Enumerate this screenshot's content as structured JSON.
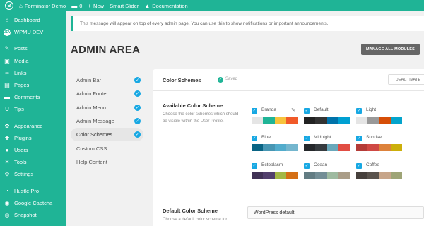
{
  "admin_bar": {
    "logo_letter": "B",
    "site_name": "Forminator Demo",
    "comments_count": "0",
    "new_label": "New",
    "slider_label": "Smart Slider",
    "documentation_label": "Documentation"
  },
  "sidebar": {
    "items": [
      {
        "label": "Dashboard",
        "icon": "dashboard-icon",
        "glyph": "⌂"
      },
      {
        "label": "WPMU DEV",
        "icon": "wpmu-dev-icon",
        "glyph": "DEV"
      },
      {
        "label": "Posts",
        "icon": "pin-icon",
        "glyph": "✎"
      },
      {
        "label": "Media",
        "icon": "media-icon",
        "glyph": "▣"
      },
      {
        "label": "Links",
        "icon": "link-icon",
        "glyph": "∞"
      },
      {
        "label": "Pages",
        "icon": "pages-icon",
        "glyph": "▤"
      },
      {
        "label": "Comments",
        "icon": "comments-icon",
        "glyph": "▬"
      },
      {
        "label": "Tips",
        "icon": "tips-icon",
        "glyph": "U"
      },
      {
        "label": "Appearance",
        "icon": "appearance-icon",
        "glyph": "✿"
      },
      {
        "label": "Plugins",
        "icon": "plugins-icon",
        "glyph": "✚"
      },
      {
        "label": "Users",
        "icon": "users-icon",
        "glyph": "●"
      },
      {
        "label": "Tools",
        "icon": "tools-icon",
        "glyph": "✕"
      },
      {
        "label": "Settings",
        "icon": "settings-icon",
        "glyph": "⚙"
      },
      {
        "label": "Hustle Pro",
        "icon": "hustle-icon",
        "glyph": "◔"
      },
      {
        "label": "Google Captcha",
        "icon": "captcha-icon",
        "glyph": "◉"
      },
      {
        "label": "Snapshot",
        "icon": "snapshot-icon",
        "glyph": "◎"
      }
    ]
  },
  "notice": {
    "text": "This message will appear on top of every admin page. You can use this to show notifications or important announcements."
  },
  "page": {
    "title": "ADMIN AREA",
    "manage_button": "MANAGE ALL MODULES"
  },
  "tabs": [
    {
      "label": "Admin Bar",
      "checked": true
    },
    {
      "label": "Admin Footer",
      "checked": true
    },
    {
      "label": "Admin Menu",
      "checked": true
    },
    {
      "label": "Admin Message",
      "checked": true
    },
    {
      "label": "Color Schemes",
      "checked": true,
      "active": true
    },
    {
      "label": "Custom CSS",
      "checked": false
    },
    {
      "label": "Help Content",
      "checked": false
    }
  ],
  "card": {
    "title": "Color Schemes",
    "status": "Saved",
    "deactivate_label": "DEACTIVATE"
  },
  "available": {
    "title": "Available Color Scheme",
    "description": "Choose the color schemes which should be visible within the User Profile."
  },
  "schemes": [
    {
      "name": "Branda",
      "colors": [
        "#e5e5e5",
        "#1fb496",
        "#f7c33d",
        "#f15a29"
      ]
    },
    {
      "name": "Default",
      "colors": [
        "#222222",
        "#333333",
        "#0073aa",
        "#00a0d2"
      ]
    },
    {
      "name": "Light",
      "colors": [
        "#e5e5e5",
        "#999999",
        "#d64e07",
        "#04a4cc"
      ]
    },
    {
      "name": "Blue",
      "colors": [
        "#096484",
        "#4796b3",
        "#52accc",
        "#74b6ce"
      ]
    },
    {
      "name": "Midnight",
      "colors": [
        "#25282b",
        "#363b3f",
        "#69a8bb",
        "#e14d43"
      ]
    },
    {
      "name": "Sunrise",
      "colors": [
        "#b43c38",
        "#cf4944",
        "#dd823b",
        "#ccaf0b"
      ]
    },
    {
      "name": "Ectoplasm",
      "colors": [
        "#413256",
        "#523f6d",
        "#a3b745",
        "#d46f15"
      ]
    },
    {
      "name": "Ocean",
      "colors": [
        "#627c83",
        "#738e96",
        "#9ebaa0",
        "#aa9d88"
      ]
    },
    {
      "name": "Coffee",
      "colors": [
        "#46403c",
        "#59524c",
        "#c7a589",
        "#9ea476"
      ]
    }
  ],
  "default_scheme": {
    "title": "Default Color Scheme",
    "description": "Choose a default color scheme for",
    "selected": "WordPress default"
  }
}
